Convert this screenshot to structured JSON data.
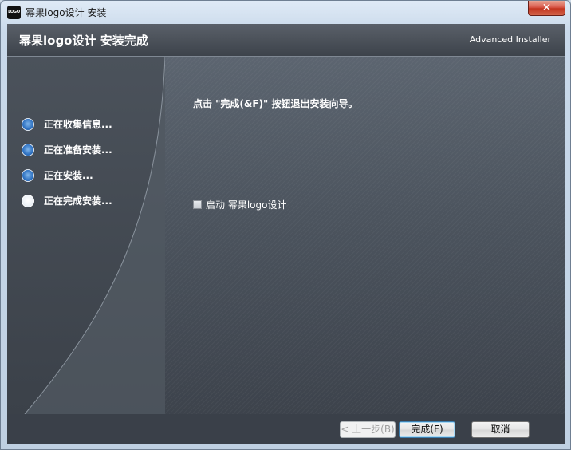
{
  "window": {
    "app_icon_text": "LOGO",
    "title": "幂果logo设计 安装",
    "close_glyph": "✕"
  },
  "header": {
    "title": "幂果logo设计 安装完成",
    "brand": "Advanced Installer"
  },
  "steps": [
    {
      "label": "正在收集信息...",
      "state": "done"
    },
    {
      "label": "正在准备安装...",
      "state": "done"
    },
    {
      "label": "正在安装...",
      "state": "done"
    },
    {
      "label": "正在完成安装...",
      "state": "current"
    }
  ],
  "content": {
    "instruction": "点击 \"完成(&F)\" 按钮退出安装向导。",
    "launch_checkbox": {
      "label": "启动 幂果logo设计",
      "checked": false
    }
  },
  "buttons": {
    "back": "< 上一步(B)",
    "finish": "完成(F)",
    "cancel": "取消"
  },
  "colors": {
    "step_done": "#2f72c2",
    "step_pending": "#ffffff",
    "close_button": "#c2351f",
    "header_bg": "#3d434b"
  }
}
